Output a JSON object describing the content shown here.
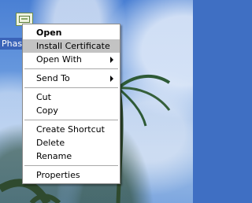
{
  "desktop": {
    "icon_label": "Phase"
  },
  "context_menu": {
    "items": [
      {
        "label": "Open",
        "bold": true
      },
      {
        "label": "Install Certificate",
        "highlighted": true
      },
      {
        "label": "Open With",
        "submenu": true
      },
      {
        "label": "Send To",
        "submenu": true
      },
      {
        "label": "Cut"
      },
      {
        "label": "Copy"
      },
      {
        "label": "Create Shortcut"
      },
      {
        "label": "Delete"
      },
      {
        "label": "Rename"
      },
      {
        "label": "Properties"
      }
    ]
  }
}
